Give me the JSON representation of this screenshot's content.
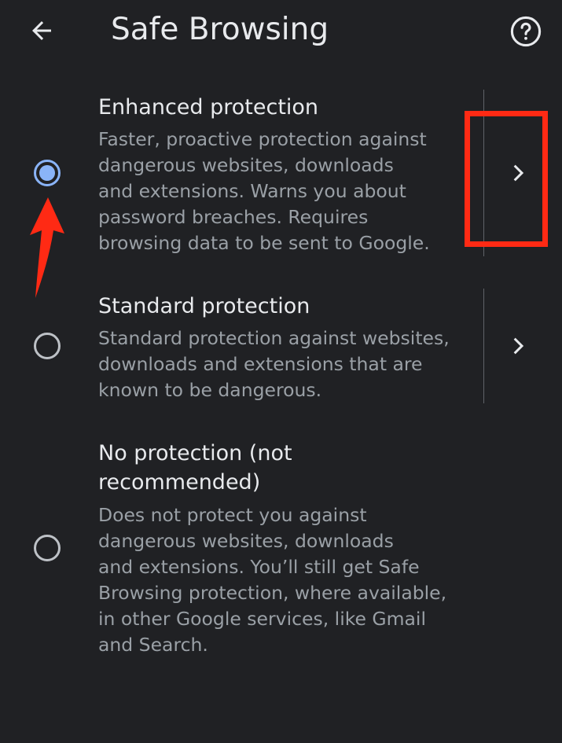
{
  "app_bar": {
    "title": "Safe Browsing",
    "back_icon": "arrow-back-icon",
    "help_icon": "help-circle-icon"
  },
  "options": [
    {
      "title": "Enhanced protection",
      "description": "Faster, proactive protection against dangerous websites, downloads and extensions. Warns you about password breaches. Requires browsing data to be sent to Google.",
      "description_lines": [
        "Faster, proactive protection against",
        "dangerous websites, downloads",
        "and extensions. Warns you about",
        "password breaches. Requires",
        "browsing data to be sent to Google."
      ],
      "selected": true,
      "has_details": true
    },
    {
      "title": "Standard protection",
      "description_lines": [
        "Standard protection against websites,",
        "downloads and extensions that are",
        "known to be dangerous."
      ],
      "selected": false,
      "has_details": true
    },
    {
      "title_lines": [
        "No protection (not",
        "recommended)"
      ],
      "description_lines": [
        "Does not protect you against",
        "dangerous websites, downloads",
        "and extensions. You’ll still get Safe",
        "Browsing protection, where available,",
        "in other Google services, like Gmail",
        "and Search."
      ],
      "selected": false,
      "has_details": false
    }
  ],
  "annotations": {
    "highlight_color": "#ff2a14",
    "arrow_color": "#ff2a14"
  },
  "colors": {
    "background": "#202124",
    "accent": "#8ab4f8",
    "primary_text": "#e8eaed",
    "secondary_text": "#9aa0a6"
  }
}
